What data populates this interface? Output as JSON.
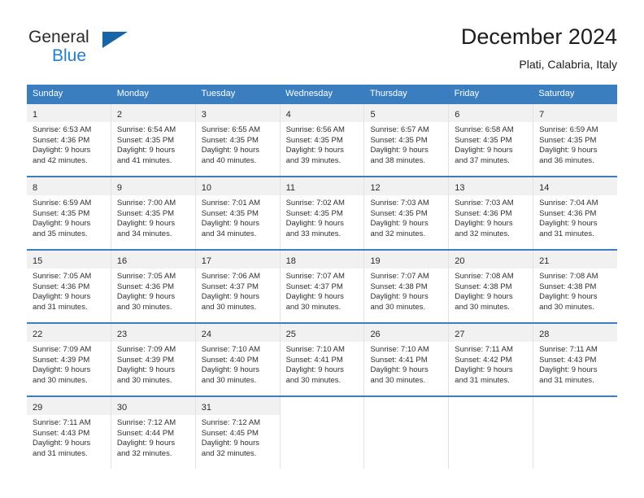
{
  "logo": {
    "word_one": "General",
    "word_two": "Blue",
    "triangle_icon": "blue-triangle-icon",
    "brand_blue": "#1f7fd0",
    "triangle_blue": "#1565a8"
  },
  "header": {
    "title": "December 2024",
    "subtitle": "Plati, Calabria, Italy"
  },
  "theme": {
    "header_bar": "#3a7ec0",
    "daynum_band": "#f1f1f1",
    "cell_border": "#e2e2e2",
    "text": "#2f2f2f"
  },
  "weekdays": [
    "Sunday",
    "Monday",
    "Tuesday",
    "Wednesday",
    "Thursday",
    "Friday",
    "Saturday"
  ],
  "weeks": [
    [
      {
        "day": "1",
        "sunrise": "Sunrise: 6:53 AM",
        "sunset": "Sunset: 4:36 PM",
        "daylight_1": "Daylight: 9 hours",
        "daylight_2": "and 42 minutes."
      },
      {
        "day": "2",
        "sunrise": "Sunrise: 6:54 AM",
        "sunset": "Sunset: 4:35 PM",
        "daylight_1": "Daylight: 9 hours",
        "daylight_2": "and 41 minutes."
      },
      {
        "day": "3",
        "sunrise": "Sunrise: 6:55 AM",
        "sunset": "Sunset: 4:35 PM",
        "daylight_1": "Daylight: 9 hours",
        "daylight_2": "and 40 minutes."
      },
      {
        "day": "4",
        "sunrise": "Sunrise: 6:56 AM",
        "sunset": "Sunset: 4:35 PM",
        "daylight_1": "Daylight: 9 hours",
        "daylight_2": "and 39 minutes."
      },
      {
        "day": "5",
        "sunrise": "Sunrise: 6:57 AM",
        "sunset": "Sunset: 4:35 PM",
        "daylight_1": "Daylight: 9 hours",
        "daylight_2": "and 38 minutes."
      },
      {
        "day": "6",
        "sunrise": "Sunrise: 6:58 AM",
        "sunset": "Sunset: 4:35 PM",
        "daylight_1": "Daylight: 9 hours",
        "daylight_2": "and 37 minutes."
      },
      {
        "day": "7",
        "sunrise": "Sunrise: 6:59 AM",
        "sunset": "Sunset: 4:35 PM",
        "daylight_1": "Daylight: 9 hours",
        "daylight_2": "and 36 minutes."
      }
    ],
    [
      {
        "day": "8",
        "sunrise": "Sunrise: 6:59 AM",
        "sunset": "Sunset: 4:35 PM",
        "daylight_1": "Daylight: 9 hours",
        "daylight_2": "and 35 minutes."
      },
      {
        "day": "9",
        "sunrise": "Sunrise: 7:00 AM",
        "sunset": "Sunset: 4:35 PM",
        "daylight_1": "Daylight: 9 hours",
        "daylight_2": "and 34 minutes."
      },
      {
        "day": "10",
        "sunrise": "Sunrise: 7:01 AM",
        "sunset": "Sunset: 4:35 PM",
        "daylight_1": "Daylight: 9 hours",
        "daylight_2": "and 34 minutes."
      },
      {
        "day": "11",
        "sunrise": "Sunrise: 7:02 AM",
        "sunset": "Sunset: 4:35 PM",
        "daylight_1": "Daylight: 9 hours",
        "daylight_2": "and 33 minutes."
      },
      {
        "day": "12",
        "sunrise": "Sunrise: 7:03 AM",
        "sunset": "Sunset: 4:35 PM",
        "daylight_1": "Daylight: 9 hours",
        "daylight_2": "and 32 minutes."
      },
      {
        "day": "13",
        "sunrise": "Sunrise: 7:03 AM",
        "sunset": "Sunset: 4:36 PM",
        "daylight_1": "Daylight: 9 hours",
        "daylight_2": "and 32 minutes."
      },
      {
        "day": "14",
        "sunrise": "Sunrise: 7:04 AM",
        "sunset": "Sunset: 4:36 PM",
        "daylight_1": "Daylight: 9 hours",
        "daylight_2": "and 31 minutes."
      }
    ],
    [
      {
        "day": "15",
        "sunrise": "Sunrise: 7:05 AM",
        "sunset": "Sunset: 4:36 PM",
        "daylight_1": "Daylight: 9 hours",
        "daylight_2": "and 31 minutes."
      },
      {
        "day": "16",
        "sunrise": "Sunrise: 7:05 AM",
        "sunset": "Sunset: 4:36 PM",
        "daylight_1": "Daylight: 9 hours",
        "daylight_2": "and 30 minutes."
      },
      {
        "day": "17",
        "sunrise": "Sunrise: 7:06 AM",
        "sunset": "Sunset: 4:37 PM",
        "daylight_1": "Daylight: 9 hours",
        "daylight_2": "and 30 minutes."
      },
      {
        "day": "18",
        "sunrise": "Sunrise: 7:07 AM",
        "sunset": "Sunset: 4:37 PM",
        "daylight_1": "Daylight: 9 hours",
        "daylight_2": "and 30 minutes."
      },
      {
        "day": "19",
        "sunrise": "Sunrise: 7:07 AM",
        "sunset": "Sunset: 4:38 PM",
        "daylight_1": "Daylight: 9 hours",
        "daylight_2": "and 30 minutes."
      },
      {
        "day": "20",
        "sunrise": "Sunrise: 7:08 AM",
        "sunset": "Sunset: 4:38 PM",
        "daylight_1": "Daylight: 9 hours",
        "daylight_2": "and 30 minutes."
      },
      {
        "day": "21",
        "sunrise": "Sunrise: 7:08 AM",
        "sunset": "Sunset: 4:38 PM",
        "daylight_1": "Daylight: 9 hours",
        "daylight_2": "and 30 minutes."
      }
    ],
    [
      {
        "day": "22",
        "sunrise": "Sunrise: 7:09 AM",
        "sunset": "Sunset: 4:39 PM",
        "daylight_1": "Daylight: 9 hours",
        "daylight_2": "and 30 minutes."
      },
      {
        "day": "23",
        "sunrise": "Sunrise: 7:09 AM",
        "sunset": "Sunset: 4:39 PM",
        "daylight_1": "Daylight: 9 hours",
        "daylight_2": "and 30 minutes."
      },
      {
        "day": "24",
        "sunrise": "Sunrise: 7:10 AM",
        "sunset": "Sunset: 4:40 PM",
        "daylight_1": "Daylight: 9 hours",
        "daylight_2": "and 30 minutes."
      },
      {
        "day": "25",
        "sunrise": "Sunrise: 7:10 AM",
        "sunset": "Sunset: 4:41 PM",
        "daylight_1": "Daylight: 9 hours",
        "daylight_2": "and 30 minutes."
      },
      {
        "day": "26",
        "sunrise": "Sunrise: 7:10 AM",
        "sunset": "Sunset: 4:41 PM",
        "daylight_1": "Daylight: 9 hours",
        "daylight_2": "and 30 minutes."
      },
      {
        "day": "27",
        "sunrise": "Sunrise: 7:11 AM",
        "sunset": "Sunset: 4:42 PM",
        "daylight_1": "Daylight: 9 hours",
        "daylight_2": "and 31 minutes."
      },
      {
        "day": "28",
        "sunrise": "Sunrise: 7:11 AM",
        "sunset": "Sunset: 4:43 PM",
        "daylight_1": "Daylight: 9 hours",
        "daylight_2": "and 31 minutes."
      }
    ],
    [
      {
        "day": "29",
        "sunrise": "Sunrise: 7:11 AM",
        "sunset": "Sunset: 4:43 PM",
        "daylight_1": "Daylight: 9 hours",
        "daylight_2": "and 31 minutes."
      },
      {
        "day": "30",
        "sunrise": "Sunrise: 7:12 AM",
        "sunset": "Sunset: 4:44 PM",
        "daylight_1": "Daylight: 9 hours",
        "daylight_2": "and 32 minutes."
      },
      {
        "day": "31",
        "sunrise": "Sunrise: 7:12 AM",
        "sunset": "Sunset: 4:45 PM",
        "daylight_1": "Daylight: 9 hours",
        "daylight_2": "and 32 minutes."
      },
      {
        "day": "",
        "sunrise": "",
        "sunset": "",
        "daylight_1": "",
        "daylight_2": ""
      },
      {
        "day": "",
        "sunrise": "",
        "sunset": "",
        "daylight_1": "",
        "daylight_2": ""
      },
      {
        "day": "",
        "sunrise": "",
        "sunset": "",
        "daylight_1": "",
        "daylight_2": ""
      },
      {
        "day": "",
        "sunrise": "",
        "sunset": "",
        "daylight_1": "",
        "daylight_2": ""
      }
    ]
  ]
}
